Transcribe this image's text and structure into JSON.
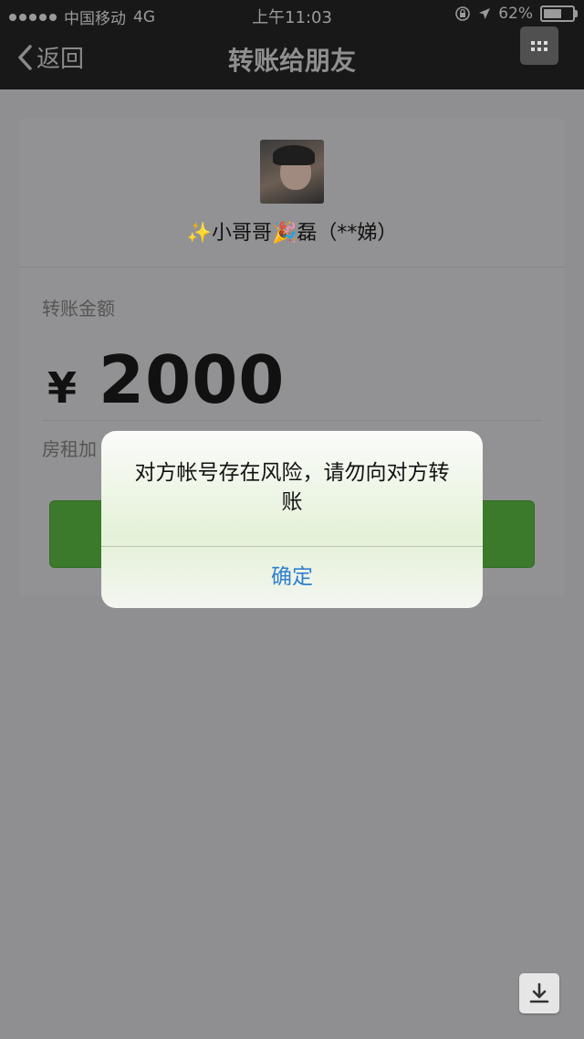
{
  "status_bar": {
    "carrier": "中国移动",
    "network": "4G",
    "time": "上午11:03",
    "battery": "62%",
    "battery_level": 0.62
  },
  "nav": {
    "back_label": "返回",
    "title": "转账给朋友"
  },
  "payee": {
    "name": "✨小哥哥🎉磊（**娣）"
  },
  "transfer": {
    "amount_label": "转账金额",
    "currency": "¥",
    "amount": "2000",
    "remark": "房租加"
  },
  "alert": {
    "message": "对方帐号存在风险，请勿向对方转账",
    "confirm_label": "确定"
  },
  "colors": {
    "confirm_text": "#2f7fd0",
    "transfer_button": "#3c7a2b"
  }
}
